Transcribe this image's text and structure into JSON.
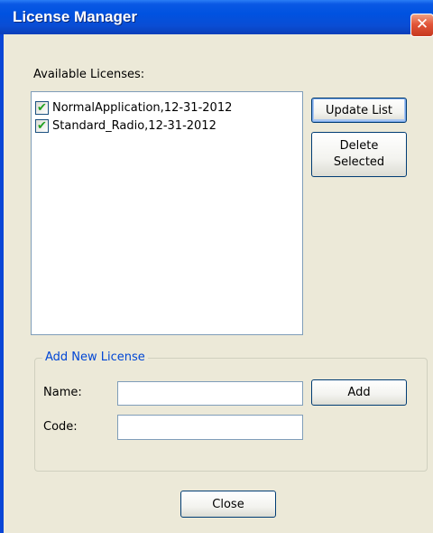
{
  "window": {
    "title": "License Manager",
    "close_glyph": "✕"
  },
  "licenses": {
    "label": "Available Licenses:",
    "items": [
      {
        "name": "NormalApplication,12-31-2012",
        "checked": true
      },
      {
        "name": "Standard_Radio,12-31-2012",
        "checked": true
      }
    ],
    "check_glyph": "✔"
  },
  "buttons": {
    "update_list": "Update List",
    "delete_selected_line1": "Delete",
    "delete_selected_line2": "Selected",
    "add": "Add",
    "close": "Close"
  },
  "add_new": {
    "group_title": "Add New License",
    "name_label": "Name:",
    "name_value": "",
    "code_label": "Code:",
    "code_value": ""
  },
  "colors": {
    "titlebar": "#0052e0",
    "group_title": "#0046d5",
    "checkmark": "#21a121",
    "close_button": "#e2563a"
  }
}
